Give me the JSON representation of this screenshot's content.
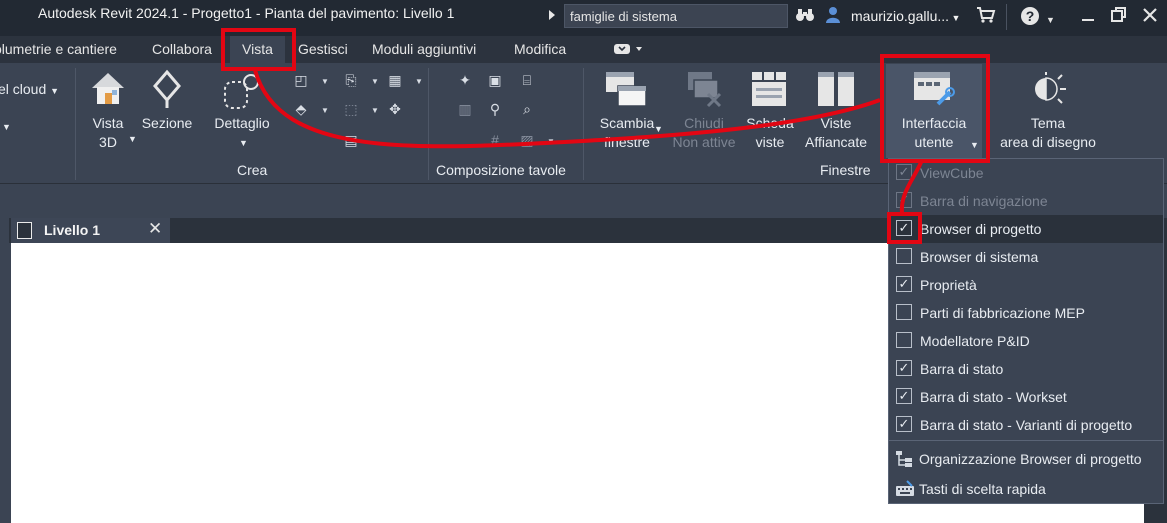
{
  "window": {
    "title": "Autodesk Revit 2024.1 - Progetto1 - Pianta del pavimento: Livello 1",
    "search_value": "famiglie di sistema",
    "user_name": "maurizio.gallu..."
  },
  "tabs": [
    {
      "label": "olumetrie e cantiere"
    },
    {
      "label": "Collabora"
    },
    {
      "label": "Vista"
    },
    {
      "label": "Gestisci"
    },
    {
      "label": "Moduli aggiuntivi"
    },
    {
      "label": "Modifica"
    }
  ],
  "ribbon": {
    "cloud_label": "el cloud",
    "buttons": {
      "vista3d": "Vista\n3D",
      "sezione": "Sezione",
      "dettaglio": "Dettaglio",
      "scambia": "Scambia\nfinestre",
      "chiudi": "Chiudi\nNon attive",
      "scheda": "Scheda\nviste",
      "affiancate": "Viste\nAffiancate",
      "interfaccia": "Interfaccia\nutente",
      "tema": "Tema\narea di disegno"
    },
    "panels": {
      "crea": "Crea",
      "composizione": "Composizione tavole",
      "finestre": "Finestre"
    }
  },
  "document": {
    "tab_title": "Livello 1"
  },
  "dropdown": {
    "items": [
      {
        "label": "ViewCube",
        "checked": true,
        "disabled": true
      },
      {
        "label": "Barra di navigazione",
        "checked": true,
        "disabled": true
      },
      {
        "label": "Browser di progetto",
        "checked": true,
        "disabled": false,
        "highlighted": true
      },
      {
        "label": "Browser di sistema",
        "checked": false,
        "disabled": false
      },
      {
        "label": "Proprietà",
        "checked": true,
        "disabled": false
      },
      {
        "label": "Parti di fabbricazione MEP",
        "checked": false,
        "disabled": false
      },
      {
        "label": "Modellatore P&ID",
        "checked": false,
        "disabled": false
      },
      {
        "label": "Barra di stato",
        "checked": true,
        "disabled": false
      },
      {
        "label": "Barra di stato - Workset",
        "checked": true,
        "disabled": false
      },
      {
        "label": "Barra di stato - Varianti di progetto",
        "checked": true,
        "disabled": false
      }
    ],
    "commands": [
      {
        "label": "Organizzazione Browser di progetto",
        "icon": "browser-organization-icon"
      },
      {
        "label": "Tasti di scelta rapida",
        "icon": "keyboard-shortcuts-icon"
      }
    ]
  },
  "colors": {
    "annotation": "#e30613",
    "ribbon_bg": "#3b4453",
    "title_bg": "#222933"
  }
}
